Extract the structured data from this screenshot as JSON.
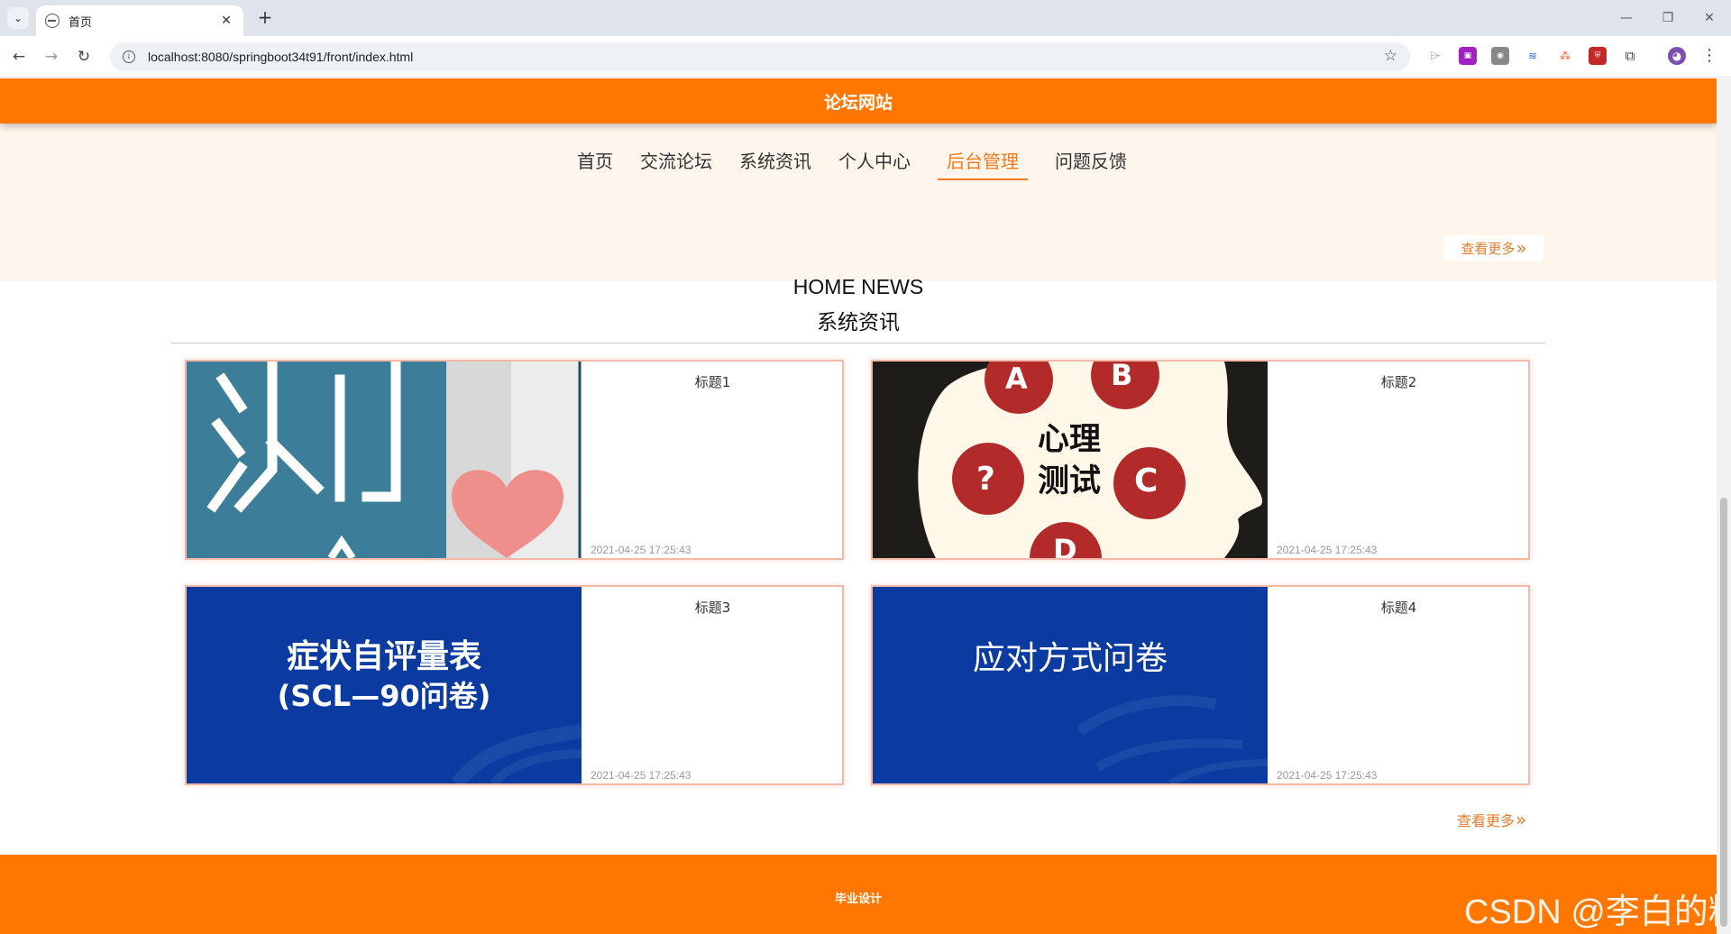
{
  "browser": {
    "tab_title": "首页",
    "tab_close": "✕",
    "new_tab": "+",
    "url": "localhost:8080/springboot34t91/front/index.html",
    "back_icon": "←",
    "forward_icon": "→",
    "reload_icon": "↻",
    "star_icon": "☆",
    "menu_icon": "⋮",
    "minimize": "—",
    "restore": "❐",
    "close": "✕"
  },
  "site": {
    "title": "论坛网站"
  },
  "menu": {
    "items": [
      {
        "label": "首页",
        "active": false
      },
      {
        "label": "交流论坛",
        "active": false
      },
      {
        "label": "系统资讯",
        "active": false
      },
      {
        "label": "个人中心",
        "active": false
      },
      {
        "label": "后台管理",
        "active": true
      },
      {
        "label": "问题反馈",
        "active": false
      }
    ]
  },
  "more_label": "查看更多",
  "more_arrow": "»",
  "news": {
    "title_en": "HOME NEWS",
    "title_cn": "系统资讯",
    "cards": [
      {
        "title": "标题1",
        "date": "2021-04-25 17:25:43",
        "image_text": "测"
      },
      {
        "title": "标题2",
        "date": "2021-04-25 17:25:43",
        "image_text": "心理测试",
        "letters": [
          "A",
          "B",
          "?",
          "C",
          "D"
        ]
      },
      {
        "title": "标题3",
        "date": "2021-04-25 17:25:43",
        "image_text": "症状自评量表",
        "image_text2": "(SCL—90问卷)"
      },
      {
        "title": "标题4",
        "date": "2021-04-25 17:25:43",
        "image_text": "应对方式问卷"
      }
    ]
  },
  "footer": {
    "text": "毕业设计",
    "watermark": "CSDN @李白的粉"
  },
  "colors": {
    "brand_orange": "#ff7700",
    "accent": "#f37b1d",
    "nav_band": "#fef5ec",
    "card_border": "#f3b8a8"
  }
}
